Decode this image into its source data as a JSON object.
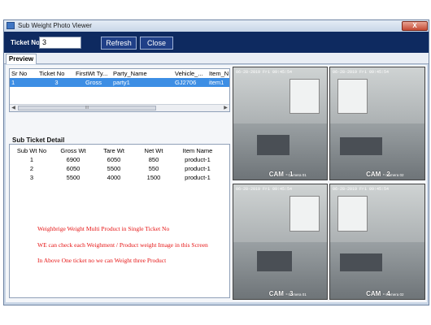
{
  "window": {
    "title": "Sub Weight Photo Viewer",
    "close_glyph": "X"
  },
  "toolbar": {
    "ticket_label": "Ticket No",
    "ticket_value": "3",
    "refresh_label": "Refresh",
    "close_label": "Close"
  },
  "tabs": [
    {
      "label": "Preview",
      "active": true
    }
  ],
  "main_grid": {
    "columns": [
      "Sr No",
      "Ticket No",
      "FirstWt Ty...",
      "Party_Name",
      "Vehicle_...",
      "Item_N"
    ],
    "rows": [
      [
        "1",
        "3",
        "Gross",
        "party1",
        "GJ2706",
        "item1"
      ]
    ],
    "scroll_thumb_glyph": "III"
  },
  "sub_ticket": {
    "title": "Sub Ticket Detail",
    "columns": [
      "Sub Wt No",
      "Gross Wt",
      "Tare Wt",
      "Net Wt",
      "Item Name"
    ],
    "rows": [
      [
        "1",
        "6900",
        "6050",
        "850",
        "product-1"
      ],
      [
        "2",
        "6050",
        "5500",
        "550",
        "product-1"
      ],
      [
        "3",
        "5500",
        "4000",
        "1500",
        "product-1"
      ]
    ]
  },
  "notes": [
    "Weighbrige Weight Multi Product in Single Ticket No",
    "WE can check each Weighment / Product weight Image in this Screen",
    "In Above One ticket no we can Weight three Product"
  ],
  "cameras": [
    {
      "label": "CAM - 1",
      "timestamp": "06-28-2019 Fri 09:45:54",
      "name": "Camera 01"
    },
    {
      "label": "CAM - 2",
      "timestamp": "06-28-2019 Fri 09:45:54",
      "name": "Camera 02"
    },
    {
      "label": "CAM - 3",
      "timestamp": "06-28-2019 Fri 09:45:54",
      "name": "Camera 01"
    },
    {
      "label": "CAM - 4",
      "timestamp": "06-28-2019 Fri 09:45:54",
      "name": "Camera 02"
    }
  ],
  "colors": {
    "toolbar": "#0e2a60",
    "selection": "#3d8ee4",
    "note_text": "#e61414"
  }
}
